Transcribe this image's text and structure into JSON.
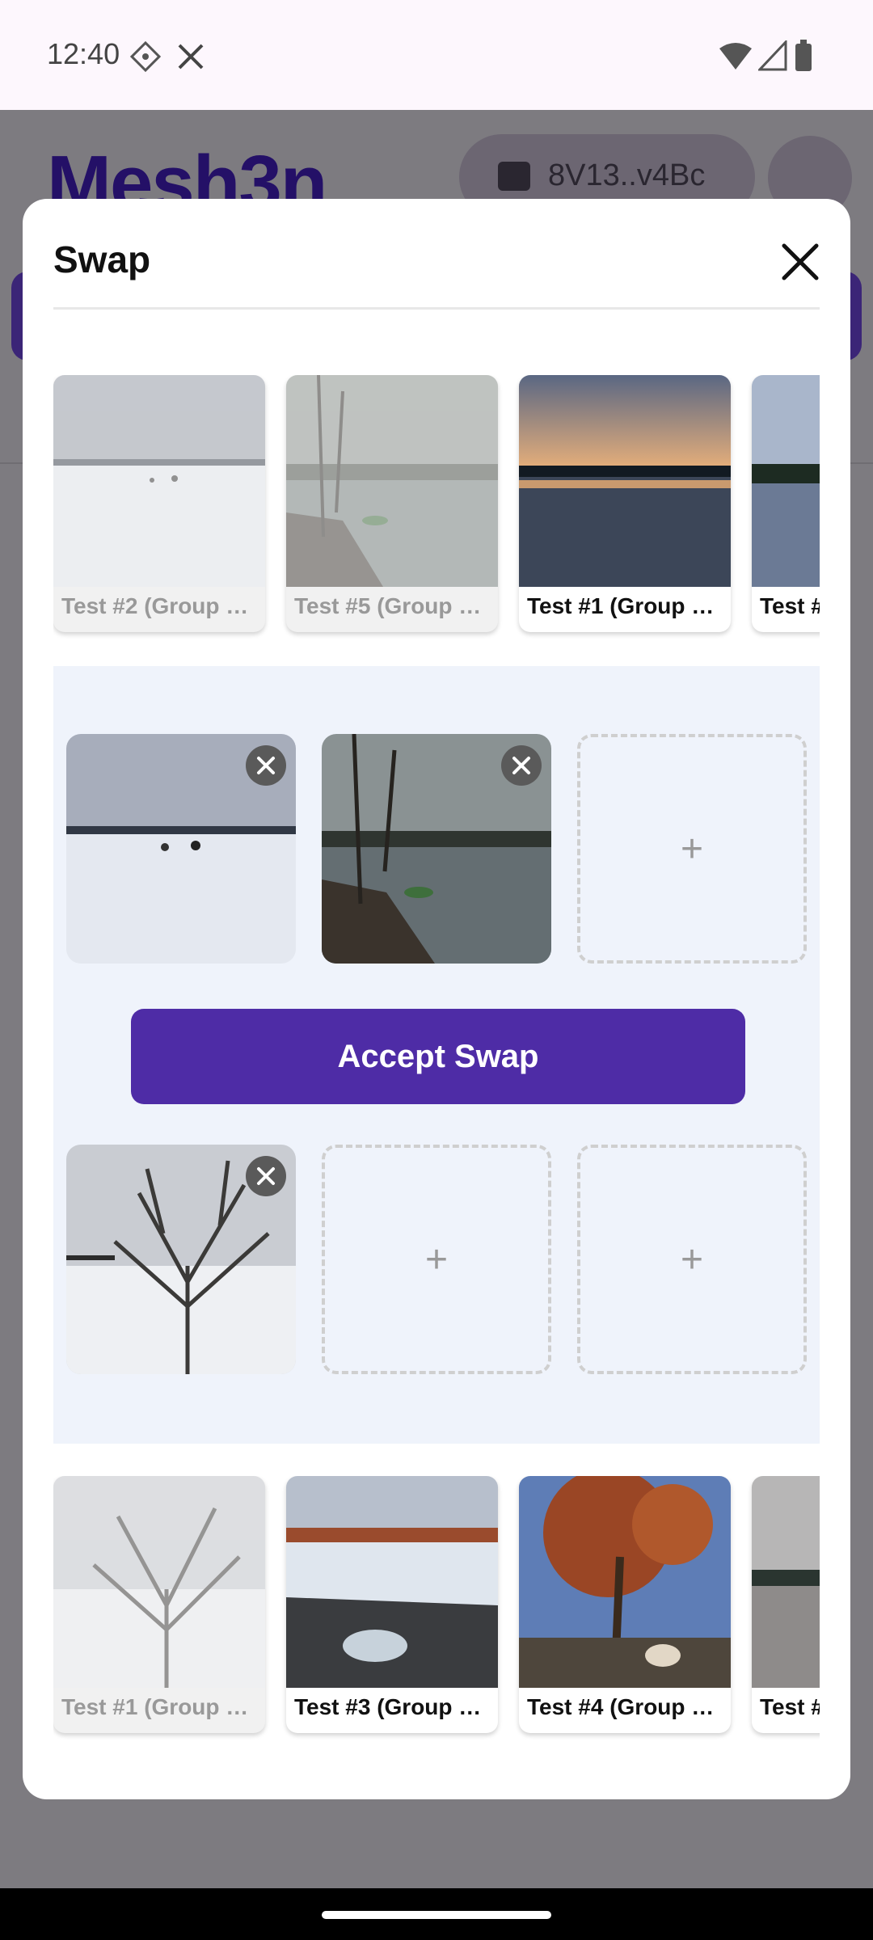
{
  "status": {
    "time": "12:40"
  },
  "background_app": {
    "logo": "Mesh3n",
    "wallet_label": "8V13..v4Bc"
  },
  "modal": {
    "title": "Swap",
    "close_icon": "close-icon"
  },
  "top_strip": [
    {
      "caption": "Test #2 (Group #…",
      "dimmed": true
    },
    {
      "caption": "Test #5 (Group #…",
      "dimmed": true
    },
    {
      "caption": "Test #1 (Group #…",
      "dimmed": false
    },
    {
      "caption": "Test #",
      "dimmed": false
    }
  ],
  "swap": {
    "accept_label": "Accept Swap",
    "top_slots": [
      {
        "filled": true
      },
      {
        "filled": true
      },
      {
        "filled": false,
        "plus": "+"
      }
    ],
    "bottom_slots": [
      {
        "filled": true
      },
      {
        "filled": false,
        "plus": "+"
      },
      {
        "filled": false,
        "plus": "+"
      }
    ]
  },
  "bottom_strip": [
    {
      "caption": "Test #1 (Group #…",
      "dimmed": true
    },
    {
      "caption": "Test #3 (Group #…",
      "dimmed": false
    },
    {
      "caption": "Test #4 (Group #…",
      "dimmed": false
    },
    {
      "caption": "Test #",
      "dimmed": false
    }
  ],
  "colors": {
    "accent": "#4e2ca6",
    "swap_area_bg": "#eff3fb"
  }
}
